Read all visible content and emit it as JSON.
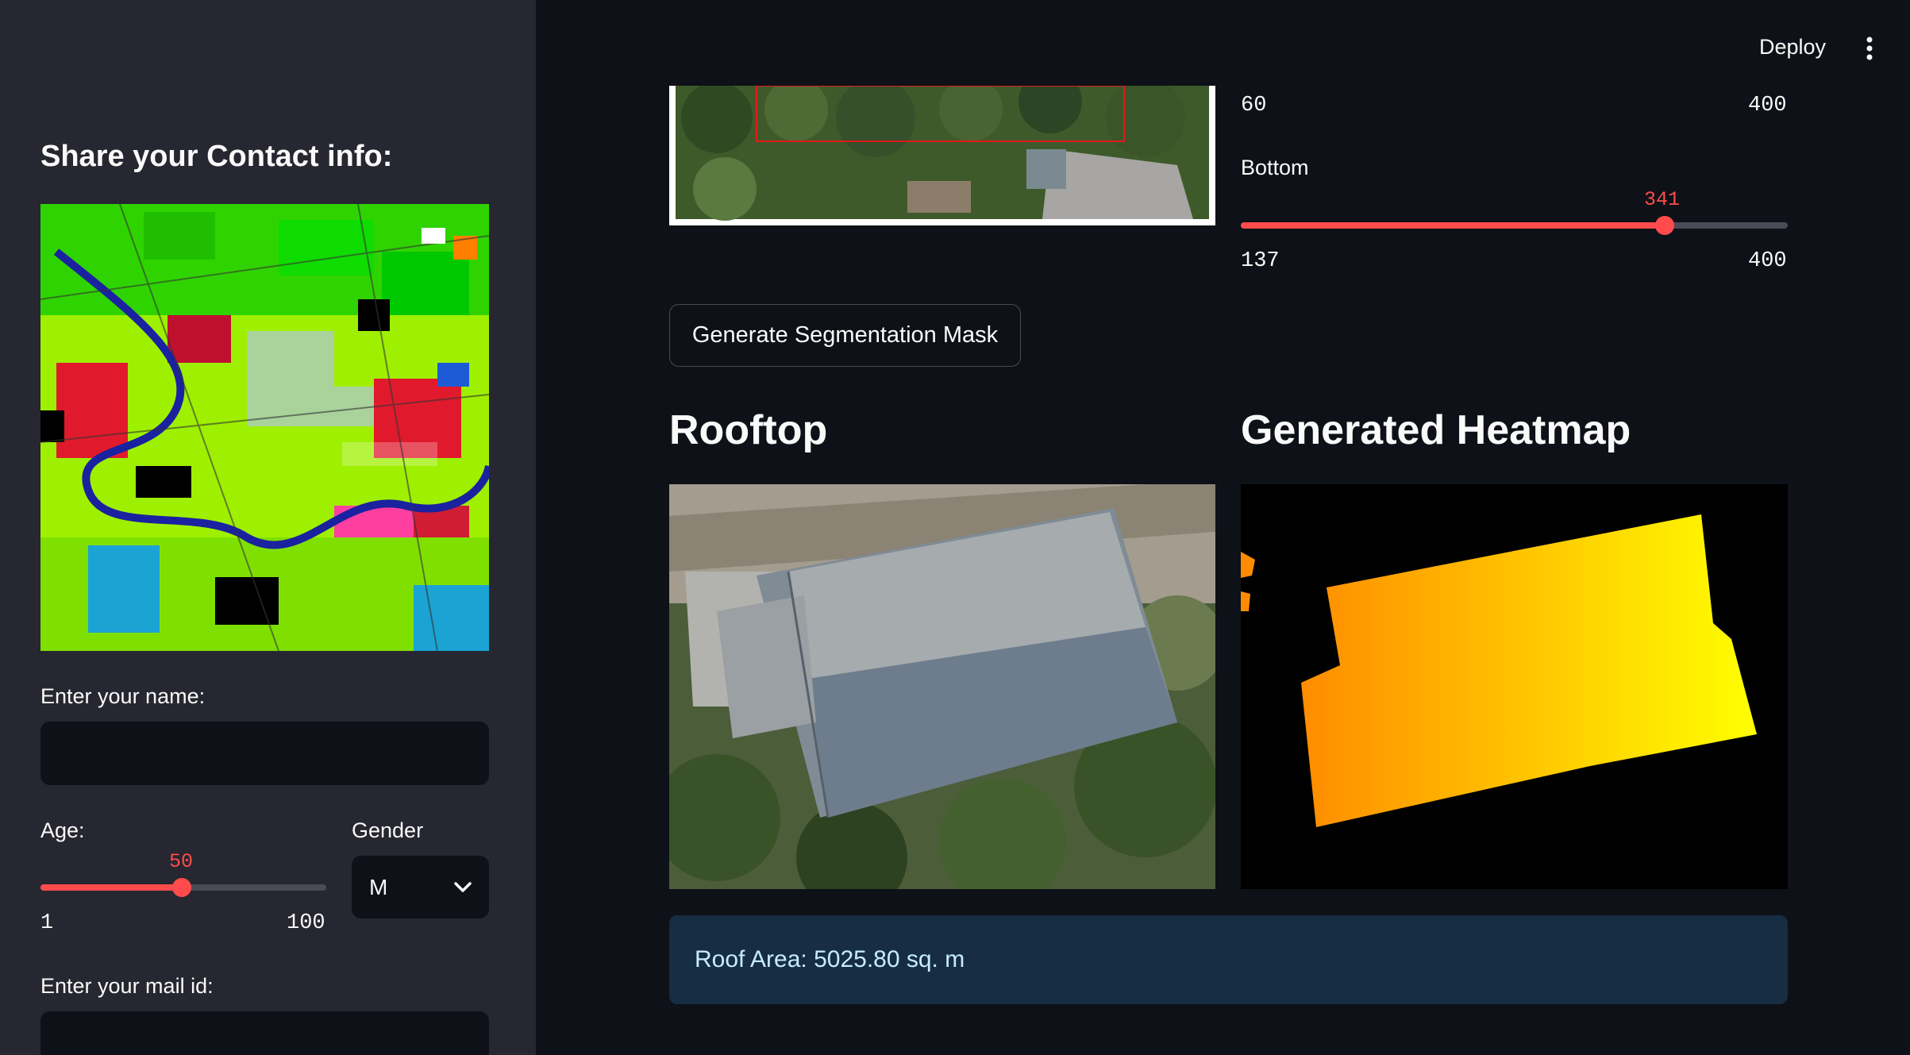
{
  "sidebar": {
    "heading": "Share your Contact info:",
    "name_label": "Enter your name:",
    "name_value": "",
    "age": {
      "label": "Age:",
      "value": "50",
      "min": "1",
      "max": "100",
      "fraction": 0.495
    },
    "gender": {
      "label": "Gender",
      "selected": "M"
    },
    "mail_label": "Enter your mail id:",
    "mail_value": ""
  },
  "header": {
    "deploy_label": "Deploy"
  },
  "crop": {
    "top_slider": {
      "min": "60",
      "max": "400"
    },
    "bottom_slider": {
      "label": "Bottom",
      "value": "341",
      "min": "137",
      "max": "400",
      "fraction": 0.7757
    },
    "crop_box_color": "#e31a1c"
  },
  "main": {
    "generate_button_label": "Generate Segmentation Mask",
    "rooftop_title": "Rooftop",
    "heatmap_title": "Generated Heatmap",
    "roof_area_text": "Roof Area: 5025.80 sq. m"
  },
  "colors": {
    "accent": "#ff4b4b",
    "sidebar_bg": "#262730",
    "main_bg": "#0e1117",
    "info_bg": "#172d43",
    "info_text": "#c7ebff",
    "heatmap_start": "#ff8c00",
    "heatmap_end": "#ffff00"
  },
  "icons": {
    "menu": "vertical-ellipsis-icon",
    "select_caret": "chevron-down-icon"
  }
}
